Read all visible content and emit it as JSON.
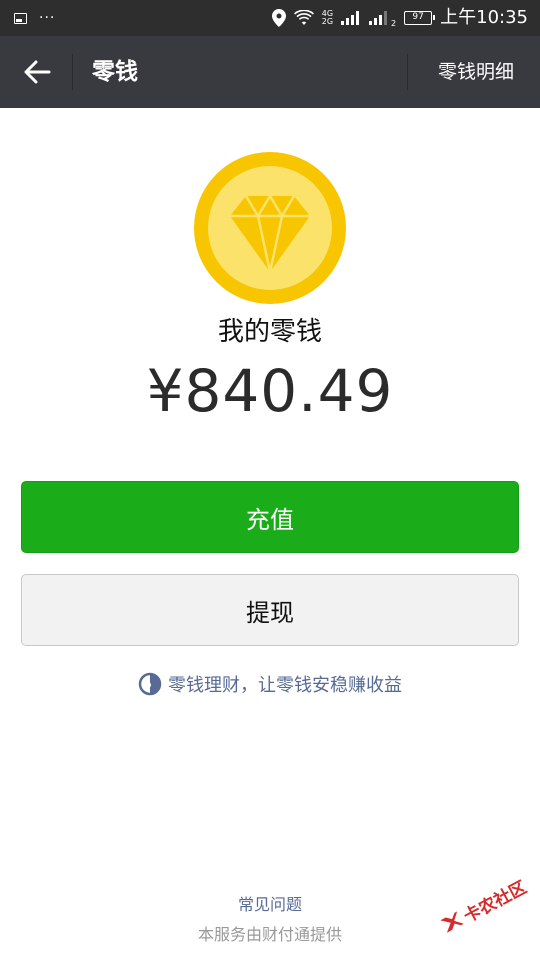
{
  "status_bar": {
    "dots": "···",
    "network_top": "4G",
    "network_bottom": "2G",
    "sim2_label": "2",
    "battery": "97",
    "time": "上午10:35"
  },
  "action_bar": {
    "title": "零钱",
    "detail_link": "零钱明细"
  },
  "wallet": {
    "label": "我的零钱",
    "balance": "¥840.49"
  },
  "buttons": {
    "top_up": "充值",
    "withdraw": "提现"
  },
  "promo": {
    "text": "零钱理财，让零钱安稳赚收益"
  },
  "footer": {
    "faq": "常见问题",
    "provider": "本服务由财付通提供"
  },
  "watermark": {
    "text": "卡农社区"
  },
  "colors": {
    "status_bar_bg": "#2e2e2e",
    "action_bar_bg": "#393a3f",
    "primary_green": "#1aad19",
    "link_blue": "#576b95",
    "coin_gold": "#f7c600",
    "coin_inner": "#fbe26a"
  },
  "icons": {
    "back": "arrow-left-icon",
    "coin": "diamond-coin-icon",
    "promo": "wealth-icon",
    "location": "location-icon",
    "wifi": "wifi-icon"
  }
}
